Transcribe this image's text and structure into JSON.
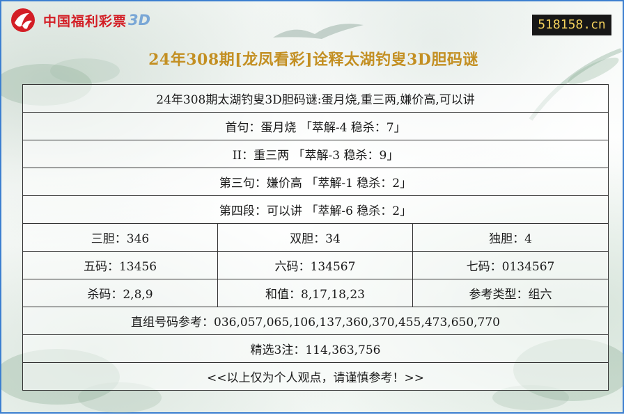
{
  "header": {
    "logo": {
      "icon": "china-welfare-lottery-logo-icon",
      "brand_text": "中国福利彩票",
      "brand_3d": "3D",
      "brand_color": "#d31e25"
    },
    "site_badge": "518158.cn",
    "title": "24年308期[龙凤看彩]诠释太湖钓叟3D胆码谜"
  },
  "colors": {
    "frame_border": "#3c7fd0",
    "title": "#c38f22",
    "badge_bg": "#171717",
    "badge_text": "#f4d25c",
    "table_border": "#333333"
  },
  "table": {
    "riddle_title": "24年308期太湖钓叟3D胆码谜:蛋月烧,重三两,嫌价高,可以讲",
    "lines": [
      "首句：蛋月烧 「萃解-4 稳杀：7」",
      "II：重三两 「萃解-3 稳杀：9」",
      "第三句：嫌价高 「萃解-1 稳杀：2」",
      "第四段：可以讲 「萃解-6 稳杀：2」"
    ],
    "grid": [
      [
        "三胆：346",
        "双胆：34",
        "独胆：4"
      ],
      [
        "五码：13456",
        "六码：134567",
        "七码：0134567"
      ],
      [
        "杀码：2,8,9",
        "和值：8,17,18,23",
        "参考类型：组六"
      ]
    ],
    "direct_ref": "直组号码参考：036,057,065,106,137,360,370,455,473,650,770",
    "selected": "精选3注：114,363,756",
    "footer": "<<以上仅为个人观点，请谨慎参考！>>"
  }
}
